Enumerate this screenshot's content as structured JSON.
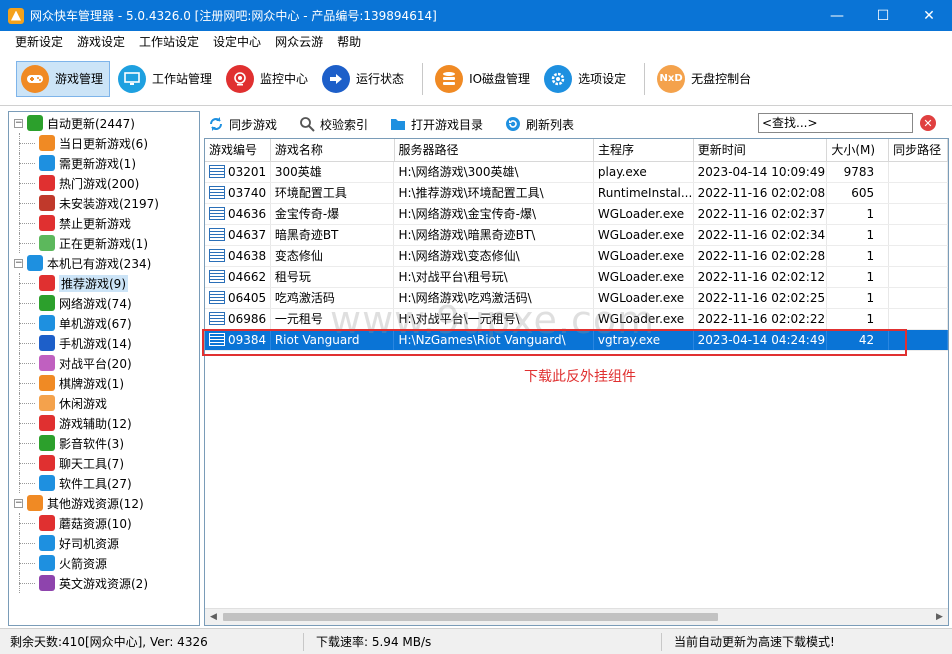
{
  "window": {
    "title": "网众快车管理器 - 5.0.4326.0 [注册网吧:网众中心 - 产品编号:139894614]",
    "minimize": "—",
    "maximize": "☐",
    "close": "✕"
  },
  "menu": [
    "更新设定",
    "游戏设定",
    "工作站设定",
    "设定中心",
    "网众云游",
    "帮助"
  ],
  "toolbar": [
    {
      "label": "游戏管理",
      "icon": "gamepad-icon",
      "color": "#f08a24",
      "active": true
    },
    {
      "label": "工作站管理",
      "icon": "monitor-icon",
      "color": "#1ea0e0"
    },
    {
      "label": "监控中心",
      "icon": "webcam-icon",
      "color": "#e03030"
    },
    {
      "label": "运行状态",
      "icon": "arrow-right-icon",
      "color": "#1d5fc9"
    },
    {
      "label": "IO磁盘管理",
      "icon": "database-icon",
      "color": "#f08a24"
    },
    {
      "label": "选项设定",
      "icon": "gear-icon",
      "color": "#1e90e0"
    },
    {
      "label": "无盘控制台",
      "icon": "nxd-logo-icon",
      "color": "#f4a24c",
      "glyph": "NxD"
    }
  ],
  "tree": [
    {
      "label": "自动更新(2447)",
      "level": 0,
      "expander": "−",
      "icon": "check-icon",
      "color": "#2ca02c"
    },
    {
      "label": "当日更新游戏(6)",
      "level": 1,
      "icon": "cone-icon",
      "color": "#f08a24"
    },
    {
      "label": "需更新游戏(1)",
      "level": 1,
      "icon": "screen-icon",
      "color": "#1e90e0"
    },
    {
      "label": "热门游戏(200)",
      "level": 1,
      "icon": "fire-icon",
      "color": "#e03030"
    },
    {
      "label": "未安装游戏(2197)",
      "level": 1,
      "icon": "package-icon",
      "color": "#c0392b"
    },
    {
      "label": "禁止更新游戏",
      "level": 1,
      "icon": "ban-icon",
      "color": "#e03030"
    },
    {
      "label": "正在更新游戏(1)",
      "level": 1,
      "icon": "sync-icon",
      "color": "#5cb85c"
    },
    {
      "label": "本机已有游戏(234)",
      "level": 0,
      "expander": "−",
      "icon": "people-icon",
      "color": "#1e90e0"
    },
    {
      "label": "推荐游戏(9)",
      "level": 1,
      "icon": "star-icon",
      "color": "#e03030",
      "selected": true
    },
    {
      "label": "网络游戏(74)",
      "level": 1,
      "icon": "globe-icon",
      "color": "#2ca02c"
    },
    {
      "label": "单机游戏(67)",
      "level": 1,
      "icon": "disk-icon",
      "color": "#1e90e0"
    },
    {
      "label": "手机游戏(14)",
      "level": 1,
      "icon": "phone-icon",
      "color": "#1d5fc9"
    },
    {
      "label": "对战平台(20)",
      "level": 1,
      "icon": "swords-icon",
      "color": "#c060c0"
    },
    {
      "label": "棋牌游戏(1)",
      "level": 1,
      "icon": "chess-icon",
      "color": "#f08a24"
    },
    {
      "label": "休闲游戏",
      "level": 1,
      "icon": "boat-icon",
      "color": "#f4a24c"
    },
    {
      "label": "游戏辅助(12)",
      "level": 1,
      "icon": "tools-icon",
      "color": "#e03030"
    },
    {
      "label": "影音软件(3)",
      "level": 1,
      "icon": "music-icon",
      "color": "#2ca02c"
    },
    {
      "label": "聊天工具(7)",
      "level": 1,
      "icon": "chat-icon",
      "color": "#e03030"
    },
    {
      "label": "软件工具(27)",
      "level": 1,
      "icon": "browser-icon",
      "color": "#1e90e0"
    },
    {
      "label": "其他游戏资源(12)",
      "level": 0,
      "expander": "−",
      "icon": "bolt-icon",
      "color": "#f08a24"
    },
    {
      "label": "蘑菇资源(10)",
      "level": 1,
      "icon": "mushroom-icon",
      "color": "#e03030"
    },
    {
      "label": "好司机资源",
      "level": 1,
      "icon": "steering-icon",
      "color": "#1e90e0"
    },
    {
      "label": "火箭资源",
      "level": 1,
      "icon": "rocket-icon",
      "color": "#1e90e0"
    },
    {
      "label": "英文游戏资源(2)",
      "level": 1,
      "icon": "cubes-icon",
      "color": "#8e44ad"
    }
  ],
  "content_toolbar": [
    {
      "label": "同步游戏",
      "icon": "sync-games-icon",
      "color": "#1e90e0"
    },
    {
      "label": "校验索引",
      "icon": "magnifier-icon",
      "color": "#666666"
    },
    {
      "label": "打开游戏目录",
      "icon": "folder-icon",
      "color": "#1e90e0"
    },
    {
      "label": "刷新列表",
      "icon": "refresh-icon",
      "color": "#1e90e0"
    }
  ],
  "search": {
    "value": "<查找...>",
    "clear": "✕"
  },
  "table": {
    "columns": [
      "游戏编号",
      "游戏名称",
      "服务器路径",
      "主程序",
      "更新时间",
      "大小(M)",
      "同步路径"
    ],
    "rows": [
      [
        "03201",
        "300英雄",
        "H:\\网络游戏\\300英雄\\",
        "play.exe",
        "2023-04-14 10:09:49",
        "9783",
        ""
      ],
      [
        "03740",
        "环境配置工具",
        "H:\\推荐游戏\\环境配置工具\\",
        "RuntimeInstal...",
        "2022-11-16 02:02:08",
        "605",
        ""
      ],
      [
        "04636",
        "金宝传奇-爆",
        "H:\\网络游戏\\金宝传奇-爆\\",
        "WGLoader.exe",
        "2022-11-16 02:02:37",
        "1",
        ""
      ],
      [
        "04637",
        "暗黑奇迹BT",
        "H:\\网络游戏\\暗黑奇迹BT\\",
        "WGLoader.exe",
        "2022-11-16 02:02:34",
        "1",
        ""
      ],
      [
        "04638",
        "变态修仙",
        "H:\\网络游戏\\变态修仙\\",
        "WGLoader.exe",
        "2022-11-16 02:02:28",
        "1",
        ""
      ],
      [
        "04662",
        "租号玩",
        "H:\\对战平台\\租号玩\\",
        "WGLoader.exe",
        "2022-11-16 02:02:12",
        "1",
        ""
      ],
      [
        "06405",
        "吃鸡激活码",
        "H:\\网络游戏\\吃鸡激活码\\",
        "WGLoader.exe",
        "2022-11-16 02:02:25",
        "1",
        ""
      ],
      [
        "06986",
        "一元租号",
        "H:\\对战平台\\一元租号\\",
        "WGLoader.exe",
        "2022-11-16 02:02:22",
        "1",
        ""
      ],
      [
        "09384",
        "Riot Vanguard",
        "H:\\NzGames\\Riot Vanguard\\",
        "vgtray.exe",
        "2023-04-14 04:24:49",
        "42",
        ""
      ]
    ],
    "selected_row": 8
  },
  "annotation": "下载此反外挂组件",
  "watermark": "www.9upxe.com",
  "statusbar": [
    "剩余天数:410[网众中心], Ver: 4326",
    "下载速率: 5.94 MB/s",
    "当前自动更新为高速下载模式!"
  ]
}
